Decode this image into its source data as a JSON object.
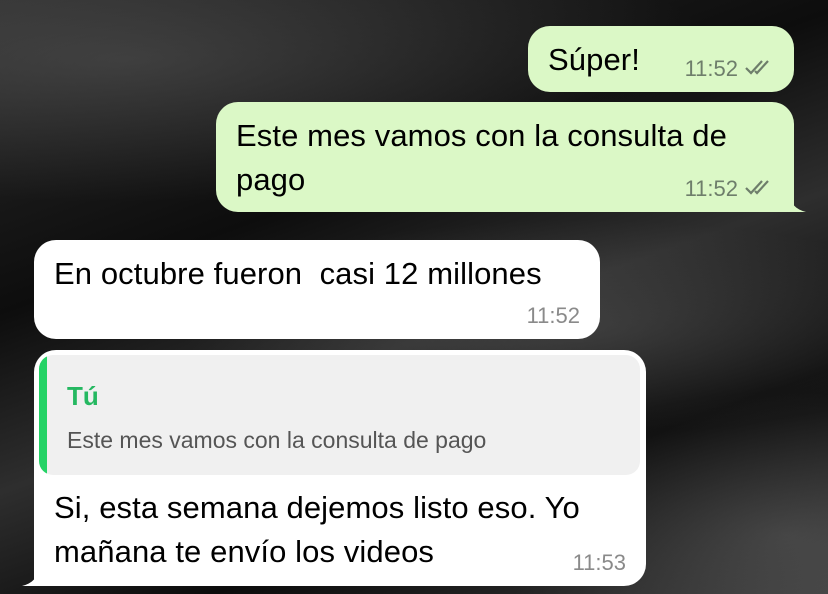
{
  "messages": [
    {
      "direction": "outgoing",
      "text": "Súper!",
      "time": "11:52",
      "status_icon": "double-check-icon"
    },
    {
      "direction": "outgoing",
      "text": "Este mes vamos con la consulta de pago",
      "time": "11:52",
      "status_icon": "double-check-icon"
    },
    {
      "direction": "incoming",
      "text": "En octubre fueron  casi 12 millones",
      "time": "11:52"
    },
    {
      "direction": "incoming",
      "reply": {
        "author": "Tú",
        "text": "Este mes vamos con la consulta de pago"
      },
      "text": "Si, esta semana dejemos listo eso. Yo mañana te envío los videos",
      "time": "11:53"
    }
  ],
  "colors": {
    "outgoing_bubble": "#dbf8c6",
    "incoming_bubble": "#ffffff",
    "reply_accent": "#25d366",
    "tick": "#6e7e6b"
  }
}
